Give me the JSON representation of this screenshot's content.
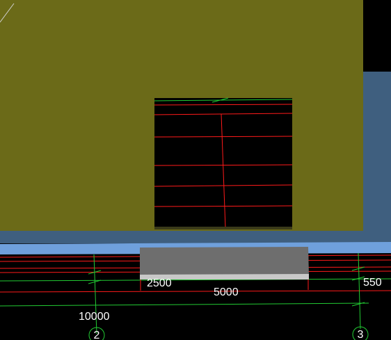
{
  "viewport": {
    "background": "#000000",
    "colors": {
      "wall": "#6b6a18",
      "sky_panel": "#3f5f7f",
      "ledge": "#6fa0dc",
      "slab": "#6e6e6e",
      "slab_edge": "#c8c8c8",
      "grid_red": "#ff1a1a",
      "grid_green": "#22cc33",
      "text": "#ffffff"
    }
  },
  "dimensions": {
    "d2500": "2500",
    "d5000": "5000",
    "d550": "550",
    "d10000": "10000"
  },
  "axes": {
    "axis_2": "2",
    "axis_3": "3"
  },
  "icons": {
    "axis_marker": "circle-axis-marker-icon"
  }
}
